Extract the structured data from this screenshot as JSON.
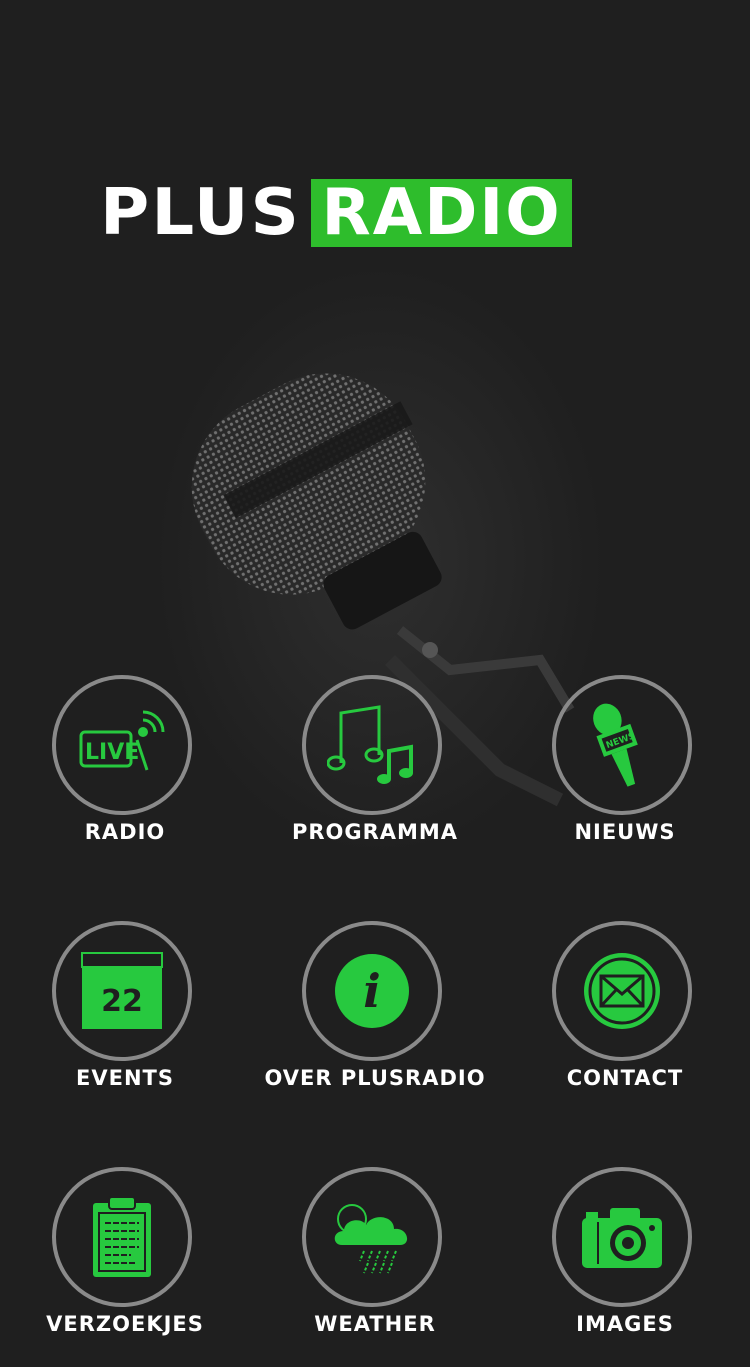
{
  "brand": {
    "word1": "PLUS",
    "word2": "RADIO",
    "accent_color": "#2ebd2c",
    "icon_color": "#27c93f"
  },
  "menu": [
    {
      "label": "RADIO",
      "icon": "live-broadcast-icon",
      "icon_text": "LIVE"
    },
    {
      "label": "PROGRAMMA",
      "icon": "music-notes-icon"
    },
    {
      "label": "NIEUWS",
      "icon": "news-microphone-icon",
      "icon_text": "NEWS"
    },
    {
      "label": "EVENTS",
      "icon": "calendar-icon",
      "icon_text": "22"
    },
    {
      "label": "OVER PLUSRADIO",
      "icon": "info-icon",
      "icon_text": "i"
    },
    {
      "label": "CONTACT",
      "icon": "mail-icon"
    },
    {
      "label": "VERZOEKJES",
      "icon": "clipboard-icon"
    },
    {
      "label": "WEATHER",
      "icon": "weather-icon"
    },
    {
      "label": "IMAGES",
      "icon": "camera-icon"
    }
  ]
}
